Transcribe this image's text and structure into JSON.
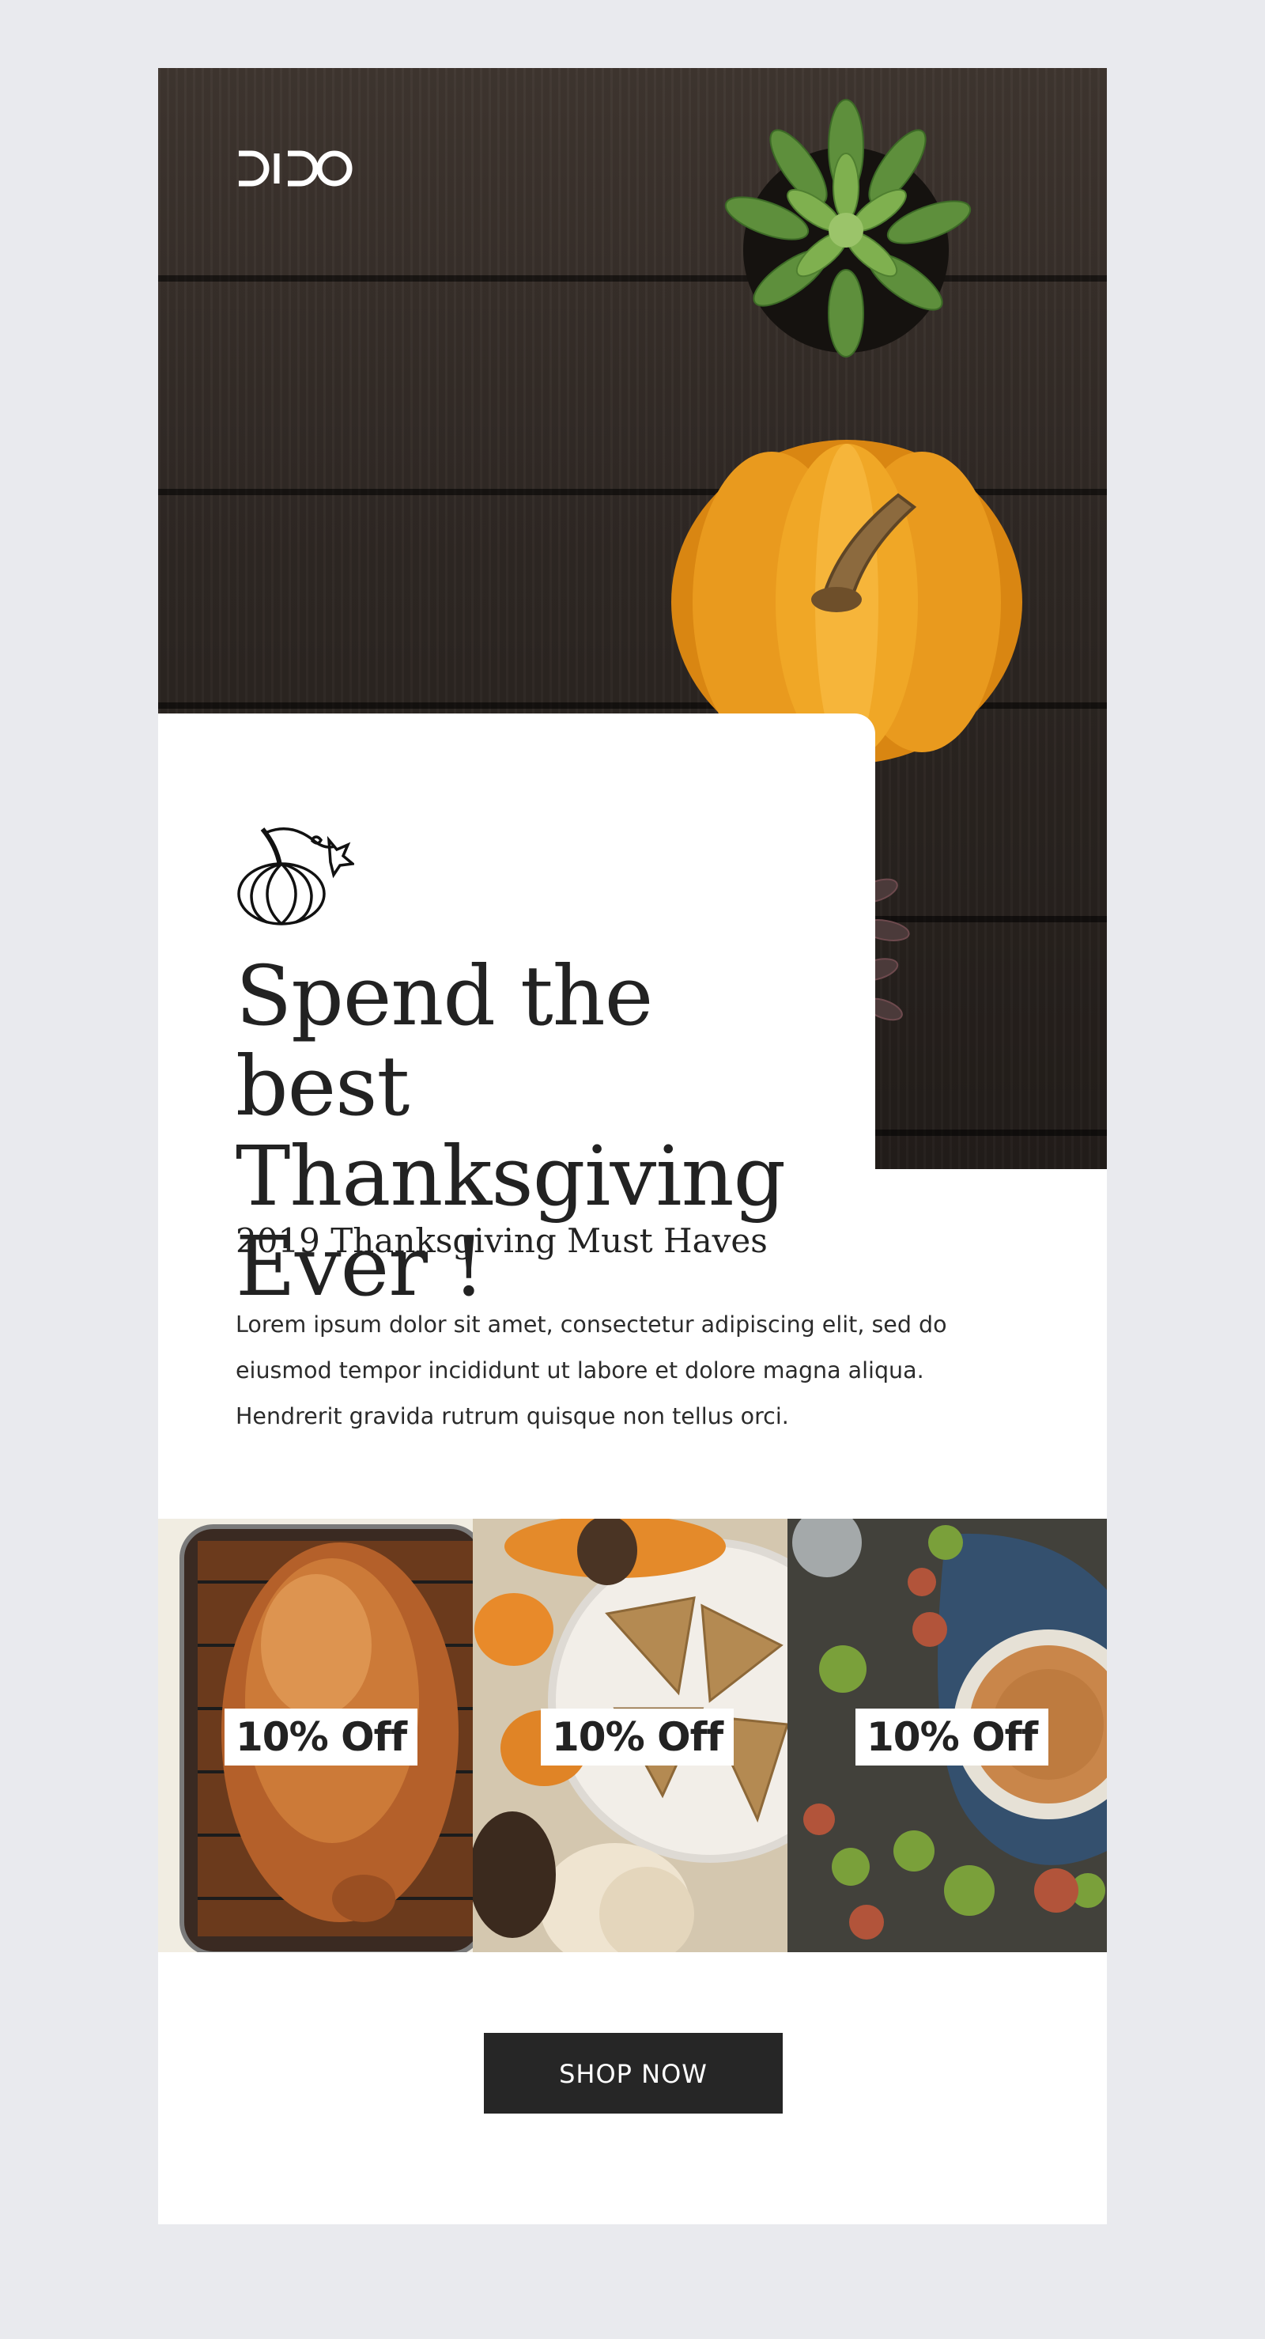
{
  "brand": {
    "logo_text": "DIDO",
    "logo_icon": "brand-logo"
  },
  "hero": {
    "headline_line1": "Spend the best",
    "headline_line2": "Thanksgiving",
    "headline_line3": "Ever !",
    "icon": "pumpkin-sketch-icon"
  },
  "intro": {
    "subheading": "2019 Thanksgiving Must Haves",
    "body": "Lorem ipsum dolor sit amet, consectetur adipiscing elit, sed do eiusmod tempor incididunt ut labore et dolore magna aliqua. Hendrerit gravida rutrum quisque non tellus orci."
  },
  "products": [
    {
      "badge": "10% Off",
      "image": "roast-turkey"
    },
    {
      "badge": "10% Off",
      "image": "scones-and-pumpkins"
    },
    {
      "badge": "10% Off",
      "image": "apple-pie-and-apples"
    }
  ],
  "cta": {
    "label": "SHOP NOW"
  },
  "colors": {
    "page_background": "#e9eaee",
    "card_background": "#ffffff",
    "text": "#222222",
    "button": "#262626",
    "pumpkin": "#e69a1c"
  }
}
